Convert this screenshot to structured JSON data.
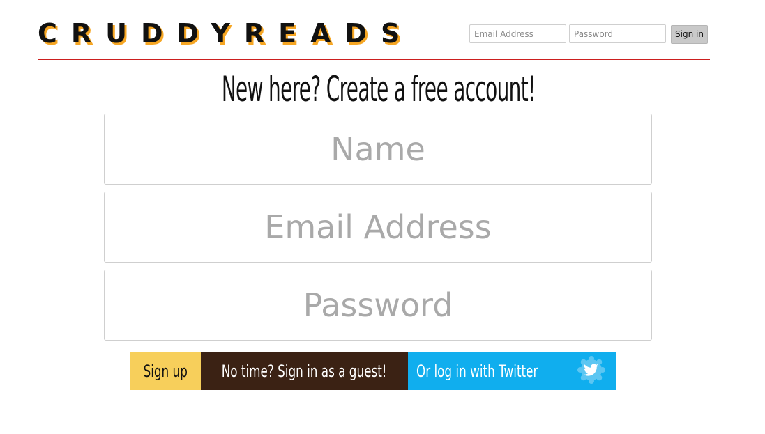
{
  "header": {
    "logo": "CRUDDYREADS",
    "email_placeholder": "Email Address",
    "password_placeholder": "Password",
    "signin_label": "Sign in"
  },
  "main": {
    "title": "New here? Create a free account!",
    "name_placeholder": "Name",
    "email_placeholder": "Email Address",
    "password_placeholder": "Password"
  },
  "buttons": {
    "signup_label": "Sign up",
    "guest_label": "No time? Sign in as a guest!",
    "twitter_label": "Or log in with Twitter",
    "twitter_icon": "twitter-bird-icon"
  },
  "colors": {
    "logo_shadow": "#f6a623",
    "header_rule": "#cc1f1f",
    "signup_bg": "#f7cf5b",
    "guest_bg": "#3b2214",
    "twitter_bg": "#10aeee"
  }
}
